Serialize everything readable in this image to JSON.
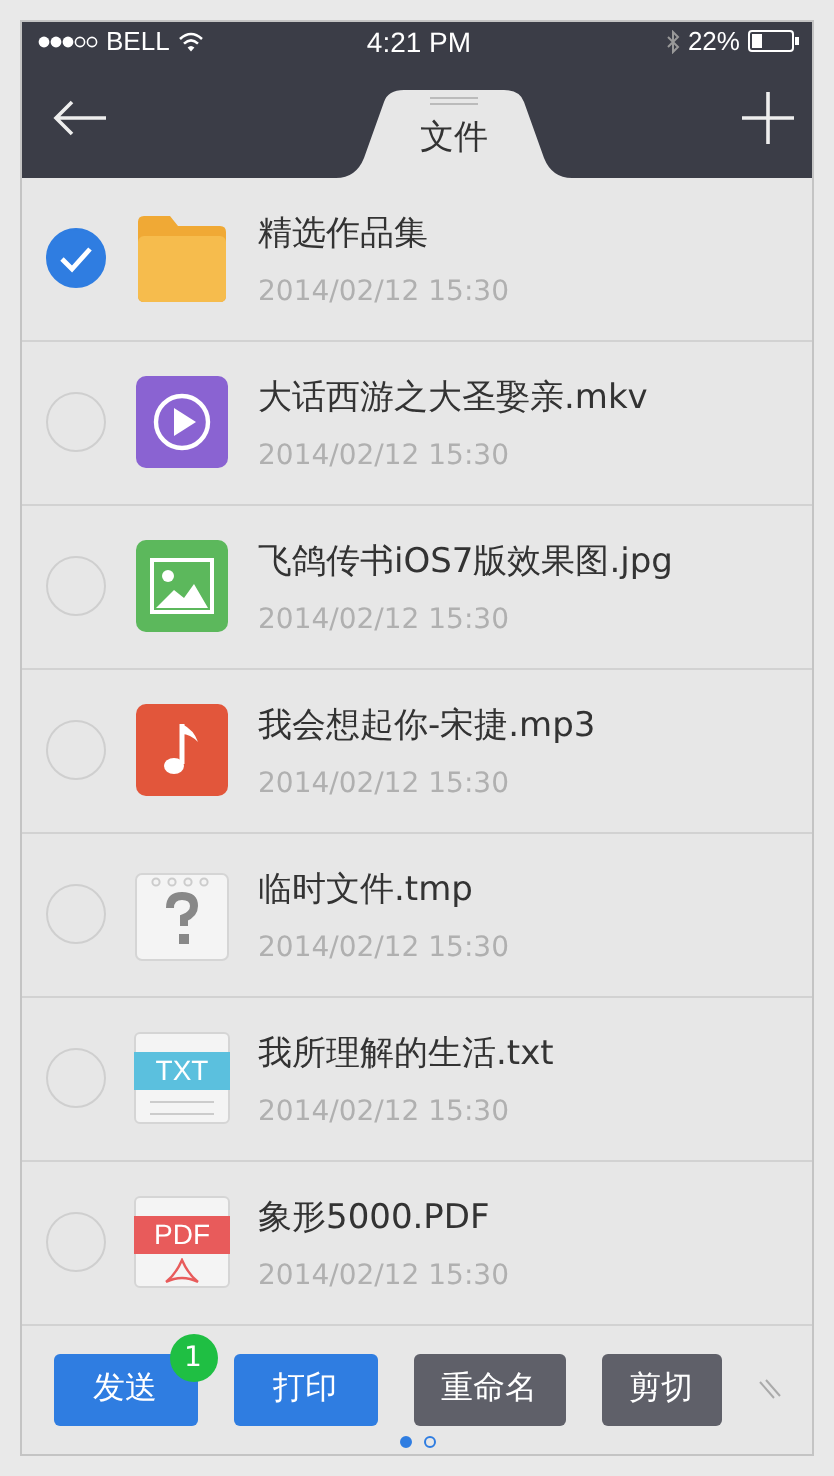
{
  "status_bar": {
    "carrier": "BELL",
    "time": "4:21 PM",
    "battery": "22%"
  },
  "nav": {
    "tab": {
      "label": "文件",
      "selected": true
    }
  },
  "files": [
    {
      "kind": "folder",
      "name": "精选作品集",
      "date": "2014/02/12 15:30",
      "checked": true
    },
    {
      "kind": "video",
      "name": "大话西游之大圣娶亲.mkv",
      "date": "2014/02/12 15:30",
      "checked": false
    },
    {
      "kind": "image",
      "name": "飞鸽传书iOS7版效果图.jpg",
      "date": "2014/02/12 15:30",
      "checked": false
    },
    {
      "kind": "music",
      "name": "我会想起你-宋捷.mp3",
      "date": "2014/02/12 15:30",
      "checked": false
    },
    {
      "kind": "unknown",
      "name": "临时文件.tmp",
      "date": "2014/02/12 15:30",
      "checked": false
    },
    {
      "kind": "txt",
      "icon_label": "TXT",
      "name": "我所理解的生活.txt",
      "date": "2014/02/12 15:30",
      "checked": false
    },
    {
      "kind": "pdf",
      "icon_label": "PDF",
      "name": "象形5000.PDF",
      "date": "2014/02/12 15:30",
      "checked": false
    }
  ],
  "actions": [
    {
      "kind": "primary",
      "label": "发送",
      "badge": "1"
    },
    {
      "kind": "primary",
      "label": "打印"
    },
    {
      "kind": "secondary",
      "label": "重命名"
    },
    {
      "kind": "secondary",
      "label": "剪切"
    }
  ],
  "pages": [
    {
      "selected": true
    },
    {
      "selected": false
    }
  ]
}
